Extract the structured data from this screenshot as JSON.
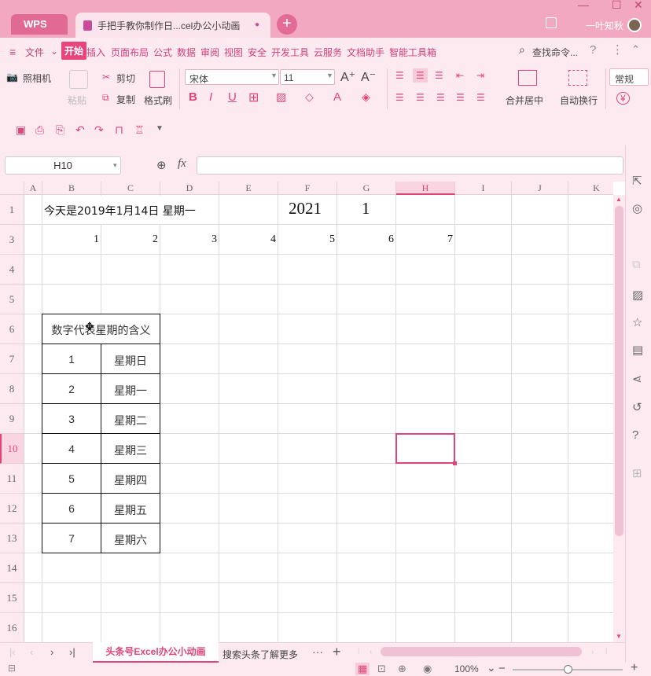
{
  "app": {
    "brand": "WPS",
    "doc_tab_title": "手把手教你制作日...cel办公小动画",
    "user_name": "一叶知秋",
    "new_tab": "+"
  },
  "menu": {
    "file": "文件",
    "items": [
      "开始",
      "插入",
      "页面布局",
      "公式",
      "数据",
      "审阅",
      "视图",
      "安全",
      "开发工具",
      "云服务",
      "文档助手",
      "智能工具箱"
    ],
    "search": "查找命令..."
  },
  "toolbar": {
    "camera": "照相机",
    "paste": "粘贴",
    "cut": "剪切",
    "copy": "复制",
    "format_painter": "格式刷",
    "font_name": "宋体",
    "font_size": "11",
    "merge_center": "合并居中",
    "wrap_text": "自动换行",
    "number_format": "常规",
    "currency": "¥"
  },
  "formula_bar": {
    "name_box": "H10",
    "fx": "fx",
    "value": ""
  },
  "grid": {
    "columns": [
      "A",
      "B",
      "C",
      "D",
      "E",
      "F",
      "G",
      "H",
      "I",
      "J",
      "K"
    ],
    "active_column": "H",
    "rows": [
      "1",
      "3",
      "4",
      "5",
      "6",
      "7",
      "8",
      "9",
      "10",
      "11",
      "12",
      "13",
      "14",
      "15",
      "16"
    ],
    "active_row": "10",
    "row1_text": "今天是2019年1月14日  星期一",
    "row1_year": "2021",
    "row1_value": "1",
    "row3_values": [
      "1",
      "2",
      "3",
      "4",
      "5",
      "6",
      "7"
    ],
    "table_header": "数字代表星期的含义",
    "table_rows": [
      [
        "1",
        "星期日"
      ],
      [
        "2",
        "星期一"
      ],
      [
        "3",
        "星期二"
      ],
      [
        "4",
        "星期三"
      ],
      [
        "5",
        "星期四"
      ],
      [
        "6",
        "星期五"
      ],
      [
        "7",
        "星期六"
      ]
    ]
  },
  "sheets": {
    "active": "头条号Excel办公小动画",
    "other": "搜索头条了解更多",
    "more": "···",
    "add": "+"
  },
  "status": {
    "zoom": "100%"
  },
  "colors": {
    "accent": "#e0457a",
    "titlebar": "#f2a8c0",
    "panel": "#fde9f0"
  }
}
